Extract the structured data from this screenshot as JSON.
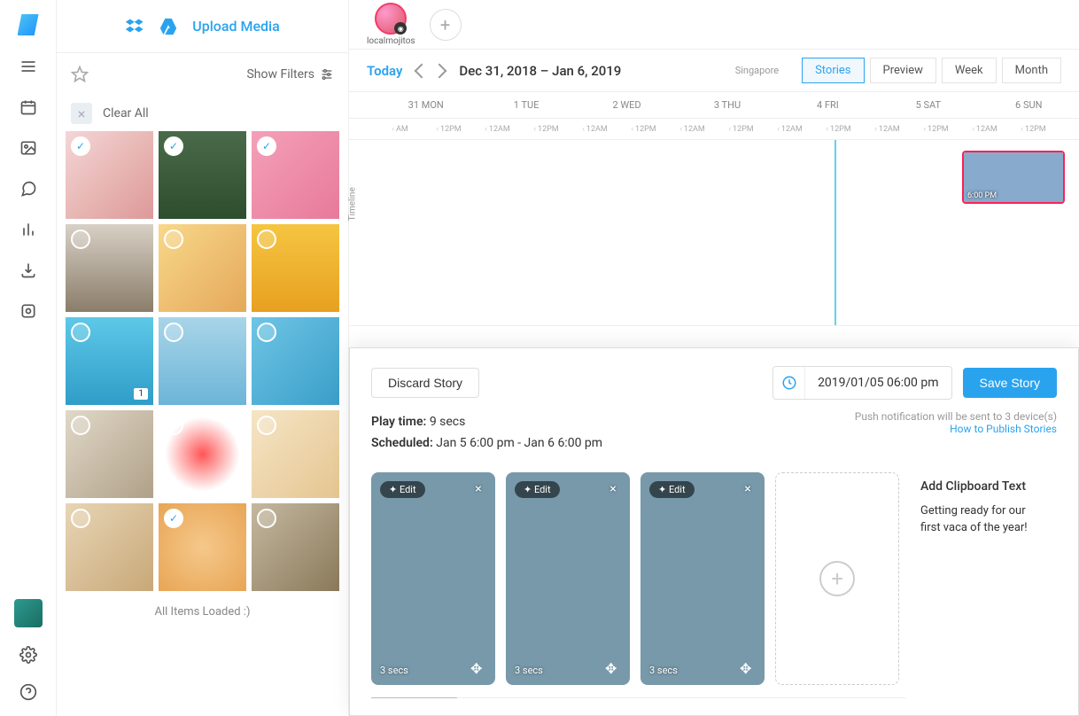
{
  "sidebar_rail": {
    "icons": [
      "menu-icon",
      "calendar-icon",
      "image-icon",
      "chat-icon",
      "analytics-icon",
      "download-icon",
      "target-icon"
    ],
    "bottom_icons": [
      "settings-icon",
      "help-icon"
    ]
  },
  "media_panel": {
    "upload_label": "Upload Media",
    "show_filters_label": "Show Filters",
    "clear_all_label": "Clear All",
    "all_loaded_label": "All Items Loaded :)",
    "thumbnails": [
      {
        "name": "media-0",
        "selected": true
      },
      {
        "name": "media-1",
        "selected": true
      },
      {
        "name": "media-2",
        "selected": true
      },
      {
        "name": "media-3",
        "selected": false
      },
      {
        "name": "media-4",
        "selected": false
      },
      {
        "name": "media-5",
        "selected": false
      },
      {
        "name": "media-6",
        "selected": false,
        "badge": "1"
      },
      {
        "name": "media-7",
        "selected": false
      },
      {
        "name": "media-8",
        "selected": false
      },
      {
        "name": "media-9",
        "selected": false
      },
      {
        "name": "media-10",
        "selected": false
      },
      {
        "name": "media-11",
        "selected": false
      },
      {
        "name": "media-12",
        "selected": false
      },
      {
        "name": "media-13",
        "selected": true
      },
      {
        "name": "media-14",
        "selected": false
      }
    ]
  },
  "account": {
    "name": "localmojitos",
    "platform": "instagram"
  },
  "calendar": {
    "today_label": "Today",
    "range": "Dec 31, 2018 – Jan 6, 2019",
    "timezone": "Singapore",
    "tabs": [
      "Stories",
      "Preview",
      "Week",
      "Month"
    ],
    "active_tab": "Stories",
    "days": [
      "31 MON",
      "1 TUE",
      "2 WED",
      "3 THU",
      "4 FRI",
      "5 SAT",
      "6 SUN"
    ],
    "hours": [
      "AM",
      "12PM",
      "12AM",
      "12PM",
      "12AM",
      "12PM",
      "12AM",
      "12PM",
      "12AM",
      "12PM",
      "12AM",
      "12PM",
      "12AM",
      "12PM"
    ],
    "timeline_label": "Timeline",
    "scheduled_post": {
      "time_label": "6:00 PM"
    }
  },
  "editor": {
    "discard_label": "Discard Story",
    "save_label": "Save Story",
    "datetime": "2019/01/05 06:00 pm",
    "play_time_label": "Play time:",
    "play_time_value": "9 secs",
    "scheduled_label": "Scheduled:",
    "scheduled_value": "Jan 5 6:00 pm - Jan 6 6:00 pm",
    "notification_text": "Push notification will be sent to 3 device(s)",
    "help_link": "How to Publish Stories",
    "cards": [
      {
        "duration": "3 secs",
        "edit": "Edit"
      },
      {
        "duration": "3 secs",
        "edit": "Edit"
      },
      {
        "duration": "3 secs",
        "edit": "Edit"
      }
    ],
    "clipboard": {
      "title": "Add Clipboard Text",
      "body": "Getting ready for our first vaca of the year!"
    }
  }
}
